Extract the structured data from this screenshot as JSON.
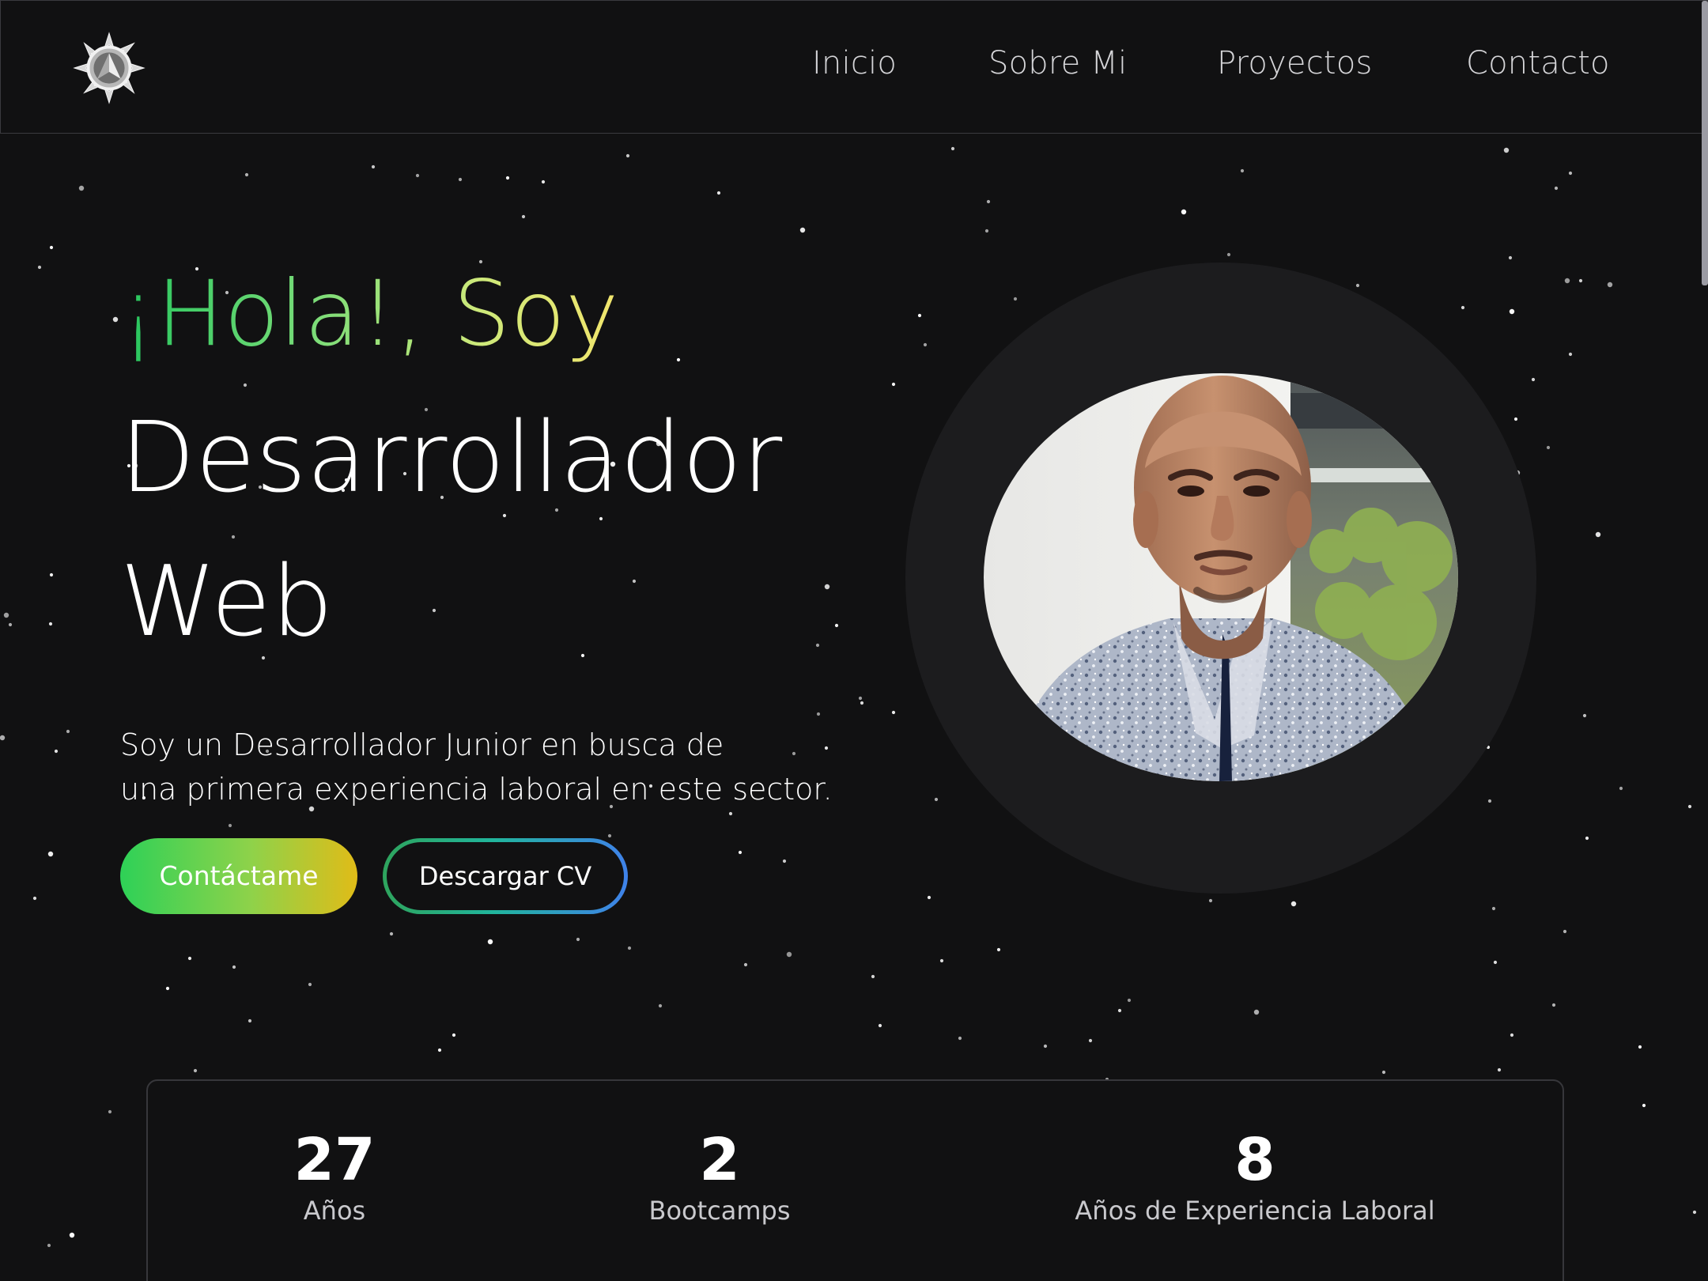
{
  "nav": {
    "logo_icon": "compass-star-logo-icon",
    "items": [
      {
        "label": "Inicio"
      },
      {
        "label": "Sobre Mi"
      },
      {
        "label": "Proyectos"
      },
      {
        "label": "Contacto"
      }
    ]
  },
  "hero": {
    "greeting": "¡Hola!, Soy",
    "title_line_1": "Desarrollador",
    "title_line_2": "Web",
    "description_line_1": "Soy un Desarrollador Junior en busca de",
    "description_line_2": "una primera experiencia laboral en este sector.",
    "primary_button": "Contáctame",
    "secondary_button": "Descargar CV"
  },
  "stats": [
    {
      "value": "27",
      "label": "Años"
    },
    {
      "value": "2",
      "label": "Bootcamps"
    },
    {
      "value": "8",
      "label": "Años de Experiencia Laboral"
    }
  ],
  "colors": {
    "background": "#111112",
    "navbar_border": "#3a3a3f",
    "greeting_gradient": [
      "#25c55d",
      "#f2e56d"
    ],
    "primary_button_gradient": [
      "#2ed157",
      "#e0bc18"
    ],
    "secondary_button_border_gradient": [
      "#2ea45d",
      "#3f82ea"
    ],
    "avatar_ring": "#1c1c1e"
  }
}
